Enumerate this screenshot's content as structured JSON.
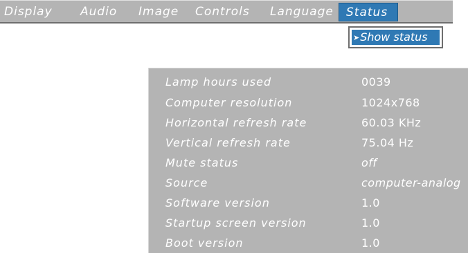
{
  "menu": {
    "items": [
      {
        "label": "Display"
      },
      {
        "label": "Audio"
      },
      {
        "label": "Image"
      },
      {
        "label": "Controls"
      },
      {
        "label": "Language"
      },
      {
        "label": "Status",
        "active": true
      }
    ]
  },
  "submenu": {
    "arrow": "➤",
    "label": "Show status"
  },
  "status": {
    "rows": [
      {
        "label": "Lamp hours used",
        "value": "0039"
      },
      {
        "label": "Computer resolution",
        "value": "1024x768"
      },
      {
        "label": "Horizontal refresh rate",
        "value": "60.03 KHz"
      },
      {
        "label": "Vertical refresh rate",
        "value": "75.04 Hz"
      },
      {
        "label": "Mute status",
        "value": "off"
      },
      {
        "label": "Source",
        "value": "computer-analog"
      },
      {
        "label": "Software version",
        "value": "1.0"
      },
      {
        "label": "Startup screen version",
        "value": "1.0"
      },
      {
        "label": "Boot version",
        "value": "1.0"
      }
    ]
  },
  "colors": {
    "menu_bg": "#b4b4b4",
    "highlight": "#2f79b4",
    "text": "#ffffff"
  }
}
